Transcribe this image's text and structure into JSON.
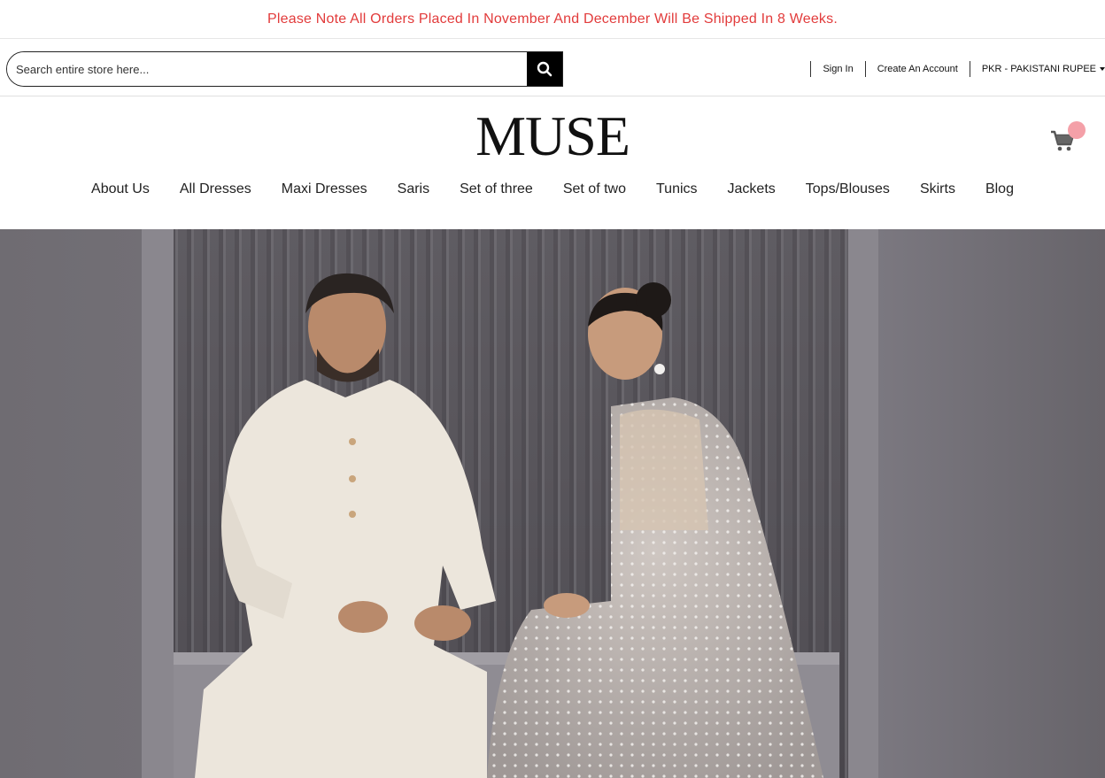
{
  "announcement": {
    "text": "Please Note All Orders Placed In November And December Will Be Shipped In 8 Weeks.",
    "color": "#e23b3b"
  },
  "search": {
    "placeholder": "Search entire store here...",
    "button_icon": "search-icon"
  },
  "account": {
    "sign_in": "Sign In",
    "create_account": "Create An Account",
    "currency": "PKR - PAKISTANI RUPEE"
  },
  "brand": {
    "logo": "MUSE"
  },
  "cart": {
    "icon": "cart-icon",
    "badge_color": "#f4a0a8"
  },
  "nav": {
    "items": [
      "About Us",
      "All Dresses",
      "Maxi Dresses",
      "Saris",
      "Set of three",
      "Set of two",
      "Tunics",
      "Jackets",
      "Tops/Blouses",
      "Skirts",
      "Blog"
    ]
  },
  "hero": {
    "image": "hero-banner-image"
  }
}
